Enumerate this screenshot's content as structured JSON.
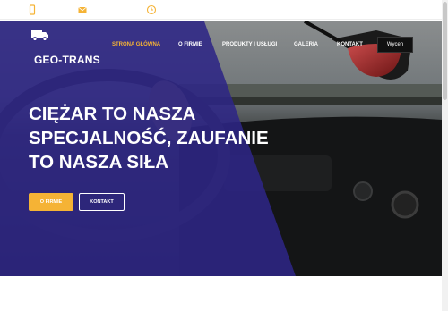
{
  "topbar": {
    "icons": [
      "phone-icon",
      "mail-icon",
      "clock-icon"
    ]
  },
  "brand": {
    "name": "GEO-TRANS",
    "logo_icon": "truck-icon"
  },
  "nav": {
    "items": [
      {
        "label": "STRONA GŁÓWNA",
        "active": true
      },
      {
        "label": "O FIRMIE",
        "active": false
      },
      {
        "label": "PRODUKTY I USŁUGI",
        "active": false
      },
      {
        "label": "GALERIA",
        "active": false
      },
      {
        "label": "KONTAKT",
        "active": false
      }
    ],
    "quote_button": "Wycen"
  },
  "hero": {
    "headline_lines": [
      "CIĘŻAR TO NASZA",
      "SPECJALNOŚĆ, ZAUFANIE",
      "TO NASZA SIŁA"
    ],
    "primary_button": "O FIRMIE",
    "secondary_button": "KONTAKT"
  },
  "colors": {
    "accent": "#f5b335",
    "overlay": "#2e2585",
    "icon": "#f5b335",
    "dark_button": "#111111"
  }
}
